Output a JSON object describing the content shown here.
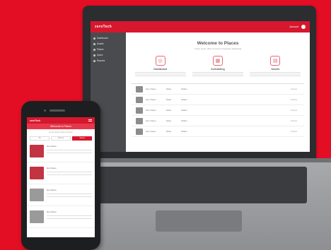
{
  "app": {
    "logo": "zeroTech",
    "user_text": "Account",
    "welcome_title": "Welcome to Places",
    "welcome_subtitle": "Lorem ipsum dolor sit amet consectetur adipiscing",
    "sidebar": {
      "items": [
        {
          "label": "Dashboard"
        },
        {
          "label": "Assets"
        },
        {
          "label": "Places"
        },
        {
          "label": "Users"
        },
        {
          "label": "Reports"
        }
      ]
    },
    "features": [
      {
        "icon": "target-icon",
        "glyph": "◎",
        "title": "Dashboard"
      },
      {
        "icon": "calendar-icon",
        "glyph": "▦",
        "title": "Scheduling"
      },
      {
        "icon": "folder-icon",
        "glyph": "▤",
        "title": "Assets"
      }
    ],
    "table_rows": [
      {
        "name": "Item Name",
        "col2": "Value",
        "col3": "Status",
        "right": "Details"
      },
      {
        "name": "Item Name",
        "col2": "Value",
        "col3": "Status",
        "right": "Details"
      },
      {
        "name": "Item Name",
        "col2": "Value",
        "col3": "Status",
        "right": "Details"
      },
      {
        "name": "Item Name",
        "col2": "Value",
        "col3": "Status",
        "right": "Details"
      },
      {
        "name": "Item Name",
        "col2": "Value",
        "col3": "Status",
        "right": "Details"
      }
    ]
  },
  "phone": {
    "logo": "zeroTech",
    "title": "Welcome to Places",
    "subtitle": "Lorem ipsum dolor sit amet",
    "tabs": [
      "All",
      "Recent",
      "Saved"
    ],
    "items": [
      {
        "name": "Item Name",
        "red": true
      },
      {
        "name": "Item Name",
        "red": true
      },
      {
        "name": "Item Name",
        "red": false
      },
      {
        "name": "Item Name",
        "red": false
      }
    ]
  },
  "colors": {
    "background": "#e30d24",
    "brand_red": "#d7172d",
    "sidebar": "#4a4b4e"
  }
}
